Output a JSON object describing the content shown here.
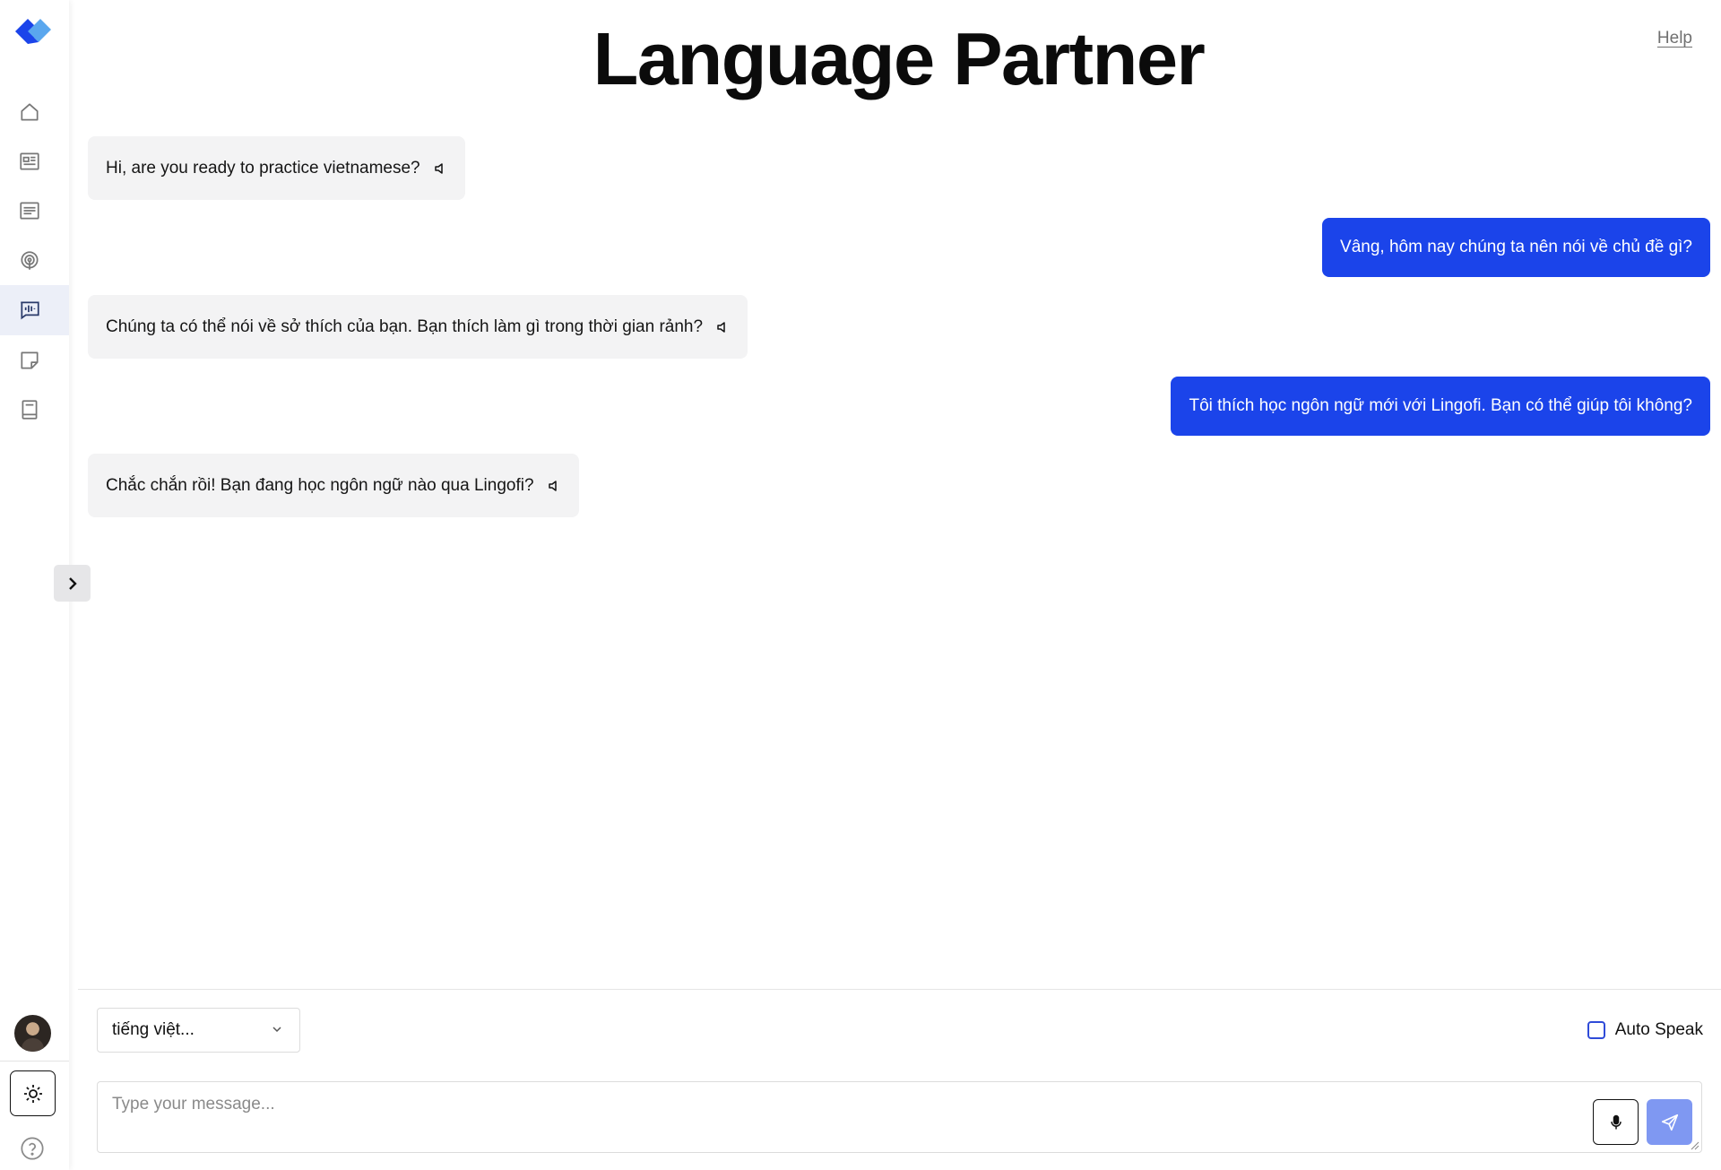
{
  "sidebar": {
    "items": [
      {
        "icon": "home-icon"
      },
      {
        "icon": "newspaper-icon"
      },
      {
        "icon": "article-icon"
      },
      {
        "icon": "podcast-icon"
      },
      {
        "icon": "chat-voice-icon",
        "active": true
      },
      {
        "icon": "sticky-note-icon"
      },
      {
        "icon": "book-icon"
      }
    ],
    "theme_icon": "sun-icon",
    "help_icon": "question-circle-icon"
  },
  "header": {
    "title": "Language Partner",
    "help_label": "Help"
  },
  "messages": [
    {
      "role": "bot",
      "text": "Hi, are you ready to practice vietnamese?"
    },
    {
      "role": "user",
      "text": "Vâng, hôm nay chúng ta nên nói về chủ đề gì?"
    },
    {
      "role": "bot",
      "text": "Chúng ta có thể nói về sở thích của bạn. Bạn thích làm gì trong thời gian rảnh?"
    },
    {
      "role": "user",
      "text": "Tôi thích học ngôn ngữ mới với Lingofi. Bạn có thể giúp tôi không?"
    },
    {
      "role": "bot",
      "text": "Chắc chắn rồi! Bạn đang học ngôn ngữ nào qua Lingofi?"
    }
  ],
  "controls": {
    "language_selected": "tiếng việt...",
    "auto_speak_label": "Auto Speak",
    "auto_speak_checked": false,
    "message_placeholder": "Type your message..."
  },
  "colors": {
    "accent": "#1b44ea",
    "send_button": "#7f98f2",
    "bot_bubble": "#f3f3f4"
  }
}
